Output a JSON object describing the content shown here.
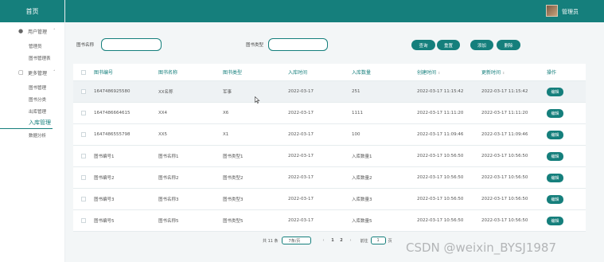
{
  "sidebar": {
    "home": "首页",
    "groups": [
      {
        "icon": "user-icon",
        "label": "用户管理",
        "items": [
          "管理员",
          "图书管理表"
        ]
      },
      {
        "icon": "grid-icon",
        "label": "更多管理",
        "items": [
          "图书管理",
          "图书分类",
          "出库管理",
          "入库管理",
          "数据分析"
        ]
      }
    ],
    "active_item": "入库管理"
  },
  "header": {
    "user": "管理员"
  },
  "search": {
    "label1": "图书名称",
    "value1": "",
    "label2": "图书类型",
    "value2": ""
  },
  "buttons": {
    "query": "查询",
    "reset": "重置",
    "add": "添加",
    "delete": "删除"
  },
  "table": {
    "columns": [
      "图书编号",
      "图书名称",
      "图书类型",
      "入库时间",
      "入库数量",
      "创建时间",
      "更新时间",
      "操作"
    ],
    "rows": [
      [
        "1647486925580",
        "XX名称",
        "军事",
        "2022-03-17",
        "251",
        "2022-03-17 11:15:42",
        "2022-03-17 11:15:42",
        "编辑"
      ],
      [
        "1647486664615",
        "XX4",
        "X6",
        "2022-03-17",
        "1111",
        "2022-03-17 11:11:20",
        "2022-03-17 11:11:20",
        "编辑"
      ],
      [
        "1647486555798",
        "XX5",
        "X1",
        "2022-03-17",
        "100",
        "2022-03-17 11:09:46",
        "2022-03-17 11:09:46",
        "编辑"
      ],
      [
        "图书编号1",
        "图书名称1",
        "图书类型1",
        "2022-03-17",
        "入库数量1",
        "2022-03-17 10:56:50",
        "2022-03-17 10:56:50",
        "编辑"
      ],
      [
        "图书编号2",
        "图书名称2",
        "图书类型2",
        "2022-03-17",
        "入库数量2",
        "2022-03-17 10:56:50",
        "2022-03-17 10:56:50",
        "编辑"
      ],
      [
        "图书编号3",
        "图书名称3",
        "图书类型3",
        "2022-03-17",
        "入库数量3",
        "2022-03-17 10:56:50",
        "2022-03-17 10:56:50",
        "编辑"
      ],
      [
        "图书编号5",
        "图书名称5",
        "图书类型5",
        "2022-03-17",
        "入库数量5",
        "2022-03-17 10:56:50",
        "2022-03-17 10:56:50",
        "编辑"
      ]
    ]
  },
  "pagination": {
    "total": "共 11 条",
    "page_size": "7条/页",
    "pages": [
      "1",
      "2"
    ],
    "goto_label": "前往",
    "goto_value": "1",
    "goto_suffix": "页"
  },
  "watermark": "CSDN @weixin_BYSJ1987",
  "colors": {
    "accent": "#157f7c",
    "background": "#f3f6f7"
  }
}
